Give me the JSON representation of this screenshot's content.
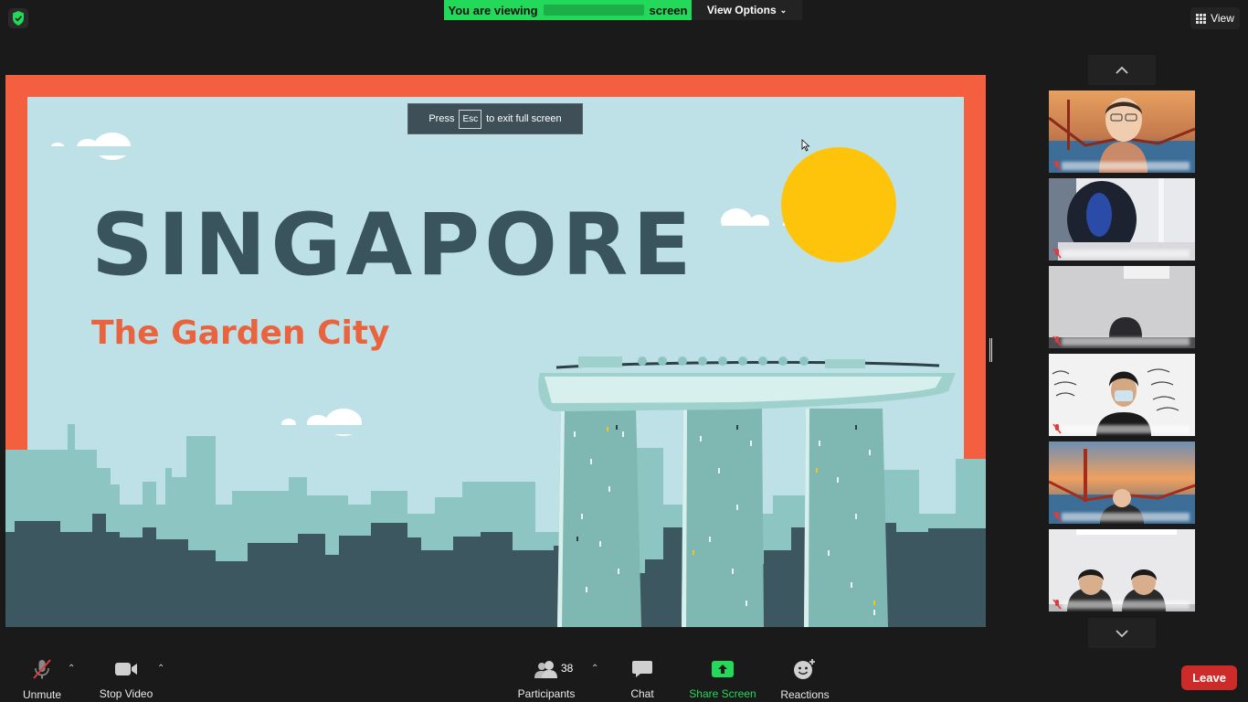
{
  "top_bar": {
    "viewing_prefix": "You are viewing",
    "viewing_suffix": "screen",
    "view_options_label": "View Options",
    "view_label": "View",
    "banner_color": "#23d959"
  },
  "slide": {
    "esc_prefix": "Press",
    "esc_key": "Esc",
    "esc_suffix": "to exit full screen",
    "title": "SINGAPORE",
    "subtitle": "The Garden City",
    "colors": {
      "frame": "#f4603f",
      "sky": "#bde1e6",
      "title": "#3a545e",
      "subtitle": "#e9633f",
      "sun": "#fec40c"
    }
  },
  "gallery": {
    "up_icon": "chevron-up-icon",
    "down_icon": "chevron-down-icon",
    "tiles": [
      {
        "scene": "golden-gate-background",
        "muted": true
      },
      {
        "scene": "head-closeup",
        "muted": true
      },
      {
        "scene": "white-room",
        "muted": true
      },
      {
        "scene": "quote-wall-masked-person",
        "muted": true
      },
      {
        "scene": "golden-gate-background",
        "muted": true
      },
      {
        "scene": "two-people-office",
        "muted": true
      }
    ]
  },
  "toolbar": {
    "unmute_label": "Unmute",
    "stop_video_label": "Stop Video",
    "participants_label": "Participants",
    "participants_count": "38",
    "chat_label": "Chat",
    "share_screen_label": "Share Screen",
    "reactions_label": "Reactions",
    "leave_label": "Leave",
    "leave_color": "#cd2a2a",
    "share_color": "#23d959"
  }
}
